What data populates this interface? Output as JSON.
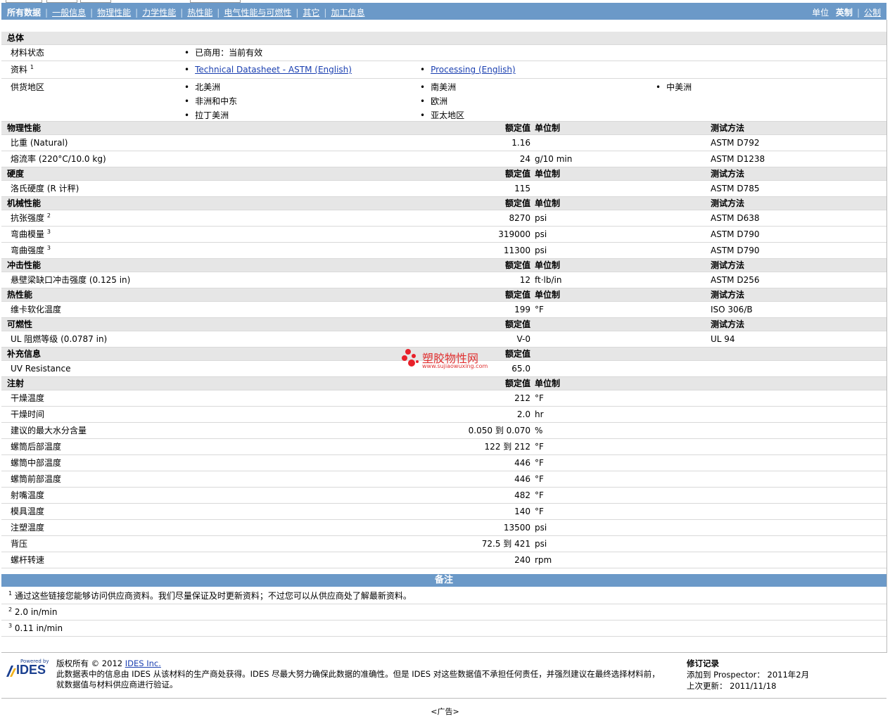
{
  "nav": {
    "tabs": [
      "所有数据",
      "一般信息",
      "物理性能",
      "力学性能",
      "热性能",
      "电气性能与可燃性",
      "其它",
      "加工信息"
    ],
    "units_label": "单位",
    "unit_active": "英制",
    "unit_other": "公制"
  },
  "general": {
    "title": "总体",
    "status_label": "材料状态",
    "status_value": "已商用：当前有效",
    "docs_label": "资料",
    "docs_sup": "1",
    "doc1": "Technical Datasheet - ASTM (English)",
    "doc2": "Processing (English)",
    "supply_label": "供货地区",
    "regions": [
      "北美洲",
      "南美洲",
      "中美洲",
      "非洲和中东",
      "欧洲",
      "拉丁美洲",
      "亚太地区"
    ]
  },
  "col_headers": {
    "nominal": "额定值",
    "unit": "单位制",
    "test": "测试方法"
  },
  "sections": [
    {
      "title": "物理性能",
      "has_unit": true,
      "has_test": true,
      "rows": [
        {
          "name": "比重",
          "cond": "(Natural)",
          "sup": "",
          "val": "1.16",
          "unit": "",
          "test": "ASTM D792"
        },
        {
          "name": "熔流率",
          "cond": "(220°C/10.0 kg)",
          "sup": "",
          "val": "24",
          "unit": "g/10 min",
          "test": "ASTM D1238"
        }
      ]
    },
    {
      "title": "硬度",
      "has_unit": true,
      "has_test": true,
      "rows": [
        {
          "name": "洛氏硬度",
          "cond": "(R 计秤)",
          "sup": "",
          "val": "115",
          "unit": "",
          "test": "ASTM D785"
        }
      ]
    },
    {
      "title": "机械性能",
      "has_unit": true,
      "has_test": true,
      "rows": [
        {
          "name": "抗张强度",
          "cond": "",
          "sup": "2",
          "val": "8270",
          "unit": "psi",
          "test": "ASTM D638"
        },
        {
          "name": "弯曲模量",
          "cond": "",
          "sup": "3",
          "val": "319000",
          "unit": "psi",
          "test": "ASTM D790"
        },
        {
          "name": "弯曲强度",
          "cond": "",
          "sup": "3",
          "val": "11300",
          "unit": "psi",
          "test": "ASTM D790"
        }
      ]
    },
    {
      "title": "冲击性能",
      "has_unit": true,
      "has_test": true,
      "rows": [
        {
          "name": "悬壁梁缺口冲击强度",
          "cond": "(0.125 in)",
          "sup": "",
          "val": "12",
          "unit": "ft·lb/in",
          "test": "ASTM D256"
        }
      ]
    },
    {
      "title": "热性能",
      "has_unit": true,
      "has_test": true,
      "rows": [
        {
          "name": "维卡软化温度",
          "cond": "",
          "sup": "",
          "val": "199",
          "unit": "°F",
          "test": "ISO 306/B"
        }
      ]
    },
    {
      "title": "可燃性",
      "has_unit": false,
      "has_test": true,
      "rows": [
        {
          "name": "UL 阻燃等级",
          "cond": "(0.0787 in)",
          "sup": "",
          "val": "V-0",
          "unit": "",
          "test": "UL 94"
        }
      ]
    },
    {
      "title": "补充信息",
      "has_unit": false,
      "has_test": false,
      "rows": [
        {
          "name": "UV Resistance",
          "cond": "",
          "sup": "",
          "val": "65.0",
          "unit": "",
          "test": ""
        }
      ]
    },
    {
      "title": "注射",
      "has_unit": true,
      "has_test": false,
      "rows": [
        {
          "name": "干燥温度",
          "cond": "",
          "sup": "",
          "val": "212",
          "unit": "°F",
          "test": ""
        },
        {
          "name": "干燥时间",
          "cond": "",
          "sup": "",
          "val": "2.0",
          "unit": "hr",
          "test": ""
        },
        {
          "name": "建议的最大水分含量",
          "cond": "",
          "sup": "",
          "val": "0.050 到  0.070",
          "unit": "%",
          "test": ""
        },
        {
          "name": "螺筒后部温度",
          "cond": "",
          "sup": "",
          "val": "122 到  212",
          "unit": "°F",
          "test": ""
        },
        {
          "name": "螺筒中部温度",
          "cond": "",
          "sup": "",
          "val": "446",
          "unit": "°F",
          "test": ""
        },
        {
          "name": "螺筒前部温度",
          "cond": "",
          "sup": "",
          "val": "446",
          "unit": "°F",
          "test": ""
        },
        {
          "name": "射嘴温度",
          "cond": "",
          "sup": "",
          "val": "482",
          "unit": "°F",
          "test": ""
        },
        {
          "name": "模具温度",
          "cond": "",
          "sup": "",
          "val": "140",
          "unit": "°F",
          "test": ""
        },
        {
          "name": "注塑温度",
          "cond": "",
          "sup": "",
          "val": "13500",
          "unit": "psi",
          "test": ""
        },
        {
          "name": "背压",
          "cond": "",
          "sup": "",
          "val": "72.5 到  421",
          "unit": "psi",
          "test": ""
        },
        {
          "name": "螺杆转速",
          "cond": "",
          "sup": "",
          "val": "240",
          "unit": "rpm",
          "test": ""
        }
      ]
    }
  ],
  "watermark": {
    "text": "塑胶物性网",
    "url": "www.sujiaowuxing.com"
  },
  "notes": {
    "title": "备注",
    "items": [
      {
        "sup": "1",
        "text": "通过这些链接您能够访问供应商资料。我们尽量保证及时更新资料；不过您可以从供应商处了解最新资料。"
      },
      {
        "sup": "2",
        "text": "2.0 in/min"
      },
      {
        "sup": "3",
        "text": "0.11 in/min"
      }
    ]
  },
  "footer": {
    "powered": "Powered by",
    "brand": "IDES",
    "copyright": "版权所有 © 2012",
    "company": "IDES Inc.",
    "disclaimer1": "此数据表中的信息由 IDES 从该材料的生产商处获得。IDES 尽最大努力确保此数据的准确性。但是 IDES 对这些数据值不承担任何责任，并强烈建议在最终选择材料前，",
    "disclaimer2": "就数据值与材料供应商进行验证。",
    "rev_title": "修订记录",
    "added_label": "添加到 Prospector：",
    "added_value": "2011年2月",
    "updated_label": "上次更新：",
    "updated_value": "2011/11/18",
    "ad": "<广告>"
  },
  "colors": {
    "nav": "#6b99c8",
    "section_bg": "#e6e6e6",
    "link": "#1a3fb0"
  }
}
